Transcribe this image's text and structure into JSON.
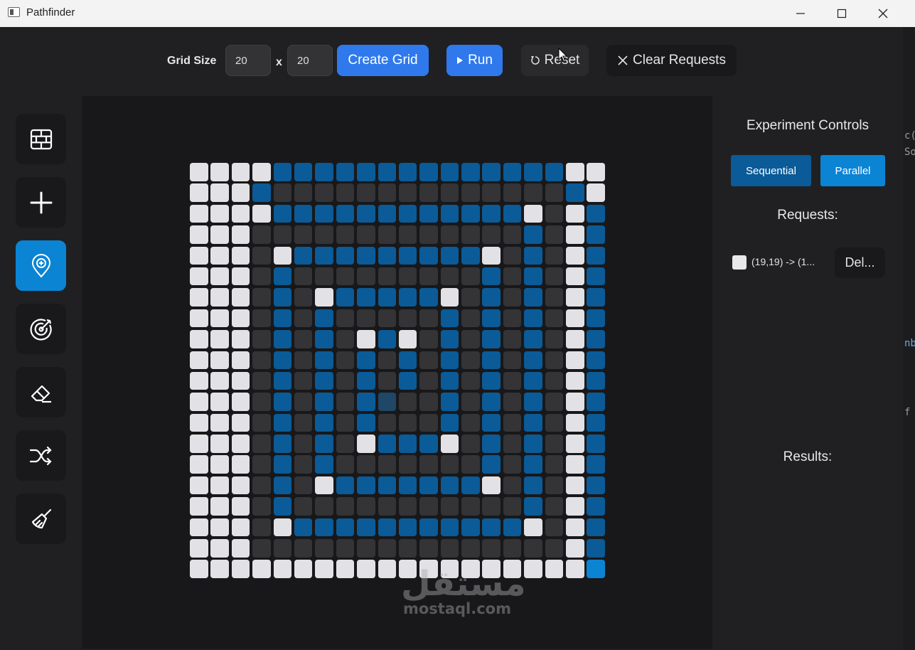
{
  "window": {
    "title": "Pathfinder"
  },
  "toolbar": {
    "grid_size_label": "Grid Size",
    "rows_value": "20",
    "x_label": "x",
    "cols_value": "20",
    "create_label": "Create Grid",
    "run_label": "Run",
    "reset_label": "Reset",
    "clear_label": "Clear Requests"
  },
  "tools": [
    "wall-tool",
    "add-tool",
    "start-pin-tool",
    "target-tool",
    "eraser-tool",
    "shuffle-tool",
    "clean-tool"
  ],
  "grid": {
    "rows": 20,
    "cols": 20,
    "legend": {
      "E": "empty",
      "W": "wall",
      "P": "path",
      "G": "goal",
      "S": "start"
    },
    "cells": [
      "WWWWPPPPPPPPPPPPPPWW",
      "WWWPEEEEEEEEEEEEEEPW",
      "WWWWPPPPPPPPPPPPWEWP",
      "WWWEEEEEEEEEEEEEPEWP",
      "WWWEWPPPPPPPPPWEPEWP",
      "WWWEPEEEEEEEEEPEPEWP",
      "WWWEPEWPPPPPWEPEPEWP",
      "WWWEPEPEEEEEPEPEPEWP",
      "WWWEPEPEWPWEPEPEPEWP",
      "WWWEPEPEPEPEPEPEPEWP",
      "WWWEPEPEPEPEPEPEPEWP",
      "WWWEPEPEPSEEPEPEPEWP",
      "WWWEPEPEPEEEPEPEPEWP",
      "WWWEPEPEWPPPWEPEPEWP",
      "WWWEPEPEEEEEEEPEPEWP",
      "WWWEPEWPPPPPPPWEPEWP",
      "WWWEPEEEEEEEEEEEPEWP",
      "WWWEWPPPPPPPPPPPWEWP",
      "WWWEEEEEEEEEEEEEEEWP",
      "WWWWWWWWWWWWWWWWWWWG"
    ]
  },
  "panel": {
    "title": "Experiment Controls",
    "sequential_label": "Sequential",
    "parallel_label": "Parallel",
    "requests_title": "Requests:",
    "request_text": "(19,19) -> (1...",
    "delete_label": "Del...",
    "results_title": "Results:"
  },
  "watermark": {
    "arabic": "مستقل",
    "latin": "mostaql.com"
  },
  "colors": {
    "empty": "#343436",
    "wall": "#e2e2e6",
    "path": "#0a5b98",
    "goal": "#0b84d4",
    "start": "#1e4866",
    "accent": "#2f79ec"
  }
}
